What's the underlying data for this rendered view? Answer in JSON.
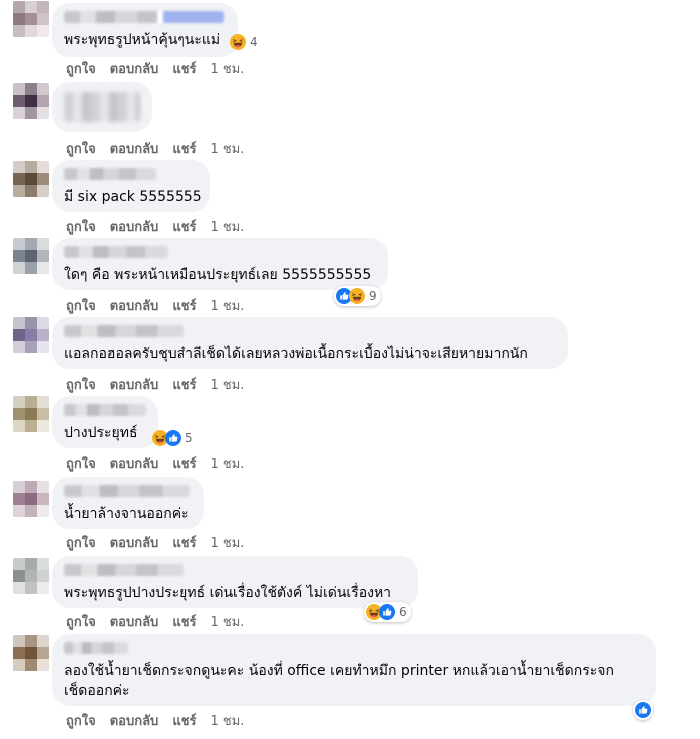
{
  "actions": {
    "like": "ถูกใจ",
    "reply": "ตอบกลับ",
    "share": "แชร์",
    "time": "1 ชม."
  },
  "colors": {
    "bubble": "#f0f2f5",
    "meta": "#65676b",
    "like_blue": "#1877f2",
    "haha_yellow": "#f7b125"
  },
  "comments": [
    {
      "text": "พระพุทธรูปหน้าคุ้นๆนะแม่",
      "reactions": [
        "haha"
      ],
      "count": "4"
    },
    {
      "text": "",
      "reactions": [],
      "count": ""
    },
    {
      "text": "มี six pack 5555555",
      "reactions": [],
      "count": ""
    },
    {
      "text": "ใดๆ คือ พระหน้าเหมือนประยุทธ์เลย 5555555555",
      "reactions": [
        "like",
        "haha"
      ],
      "count": "9"
    },
    {
      "text": "แอลกอฮอลครับชุบสำลีเช็ดได้เลยหลวงพ่อเนื้อกระเบื้องไม่น่าจะเสียหายมากนัก",
      "reactions": [],
      "count": ""
    },
    {
      "text": "ปางประยุทธ์",
      "reactions": [
        "haha",
        "like"
      ],
      "count": "5"
    },
    {
      "text": "น้ำยาล้างจานออกค่ะ",
      "reactions": [],
      "count": ""
    },
    {
      "text": "พระพุทธรูปปางประยุทธ์ เด่นเรื่องใช้ตังค์ ไม่เด่นเรื่องหา",
      "reactions": [
        "haha",
        "like"
      ],
      "count": "6"
    },
    {
      "text": "ลองใช้น้ำยาเช็ดกระจกดูนะคะ น้องที่ office เคยทำหมึก printer หกแล้วเอาน้ำยาเช็ดกระจกเช็ดออกค่ะ",
      "reactions": [
        "like"
      ],
      "count": ""
    }
  ]
}
